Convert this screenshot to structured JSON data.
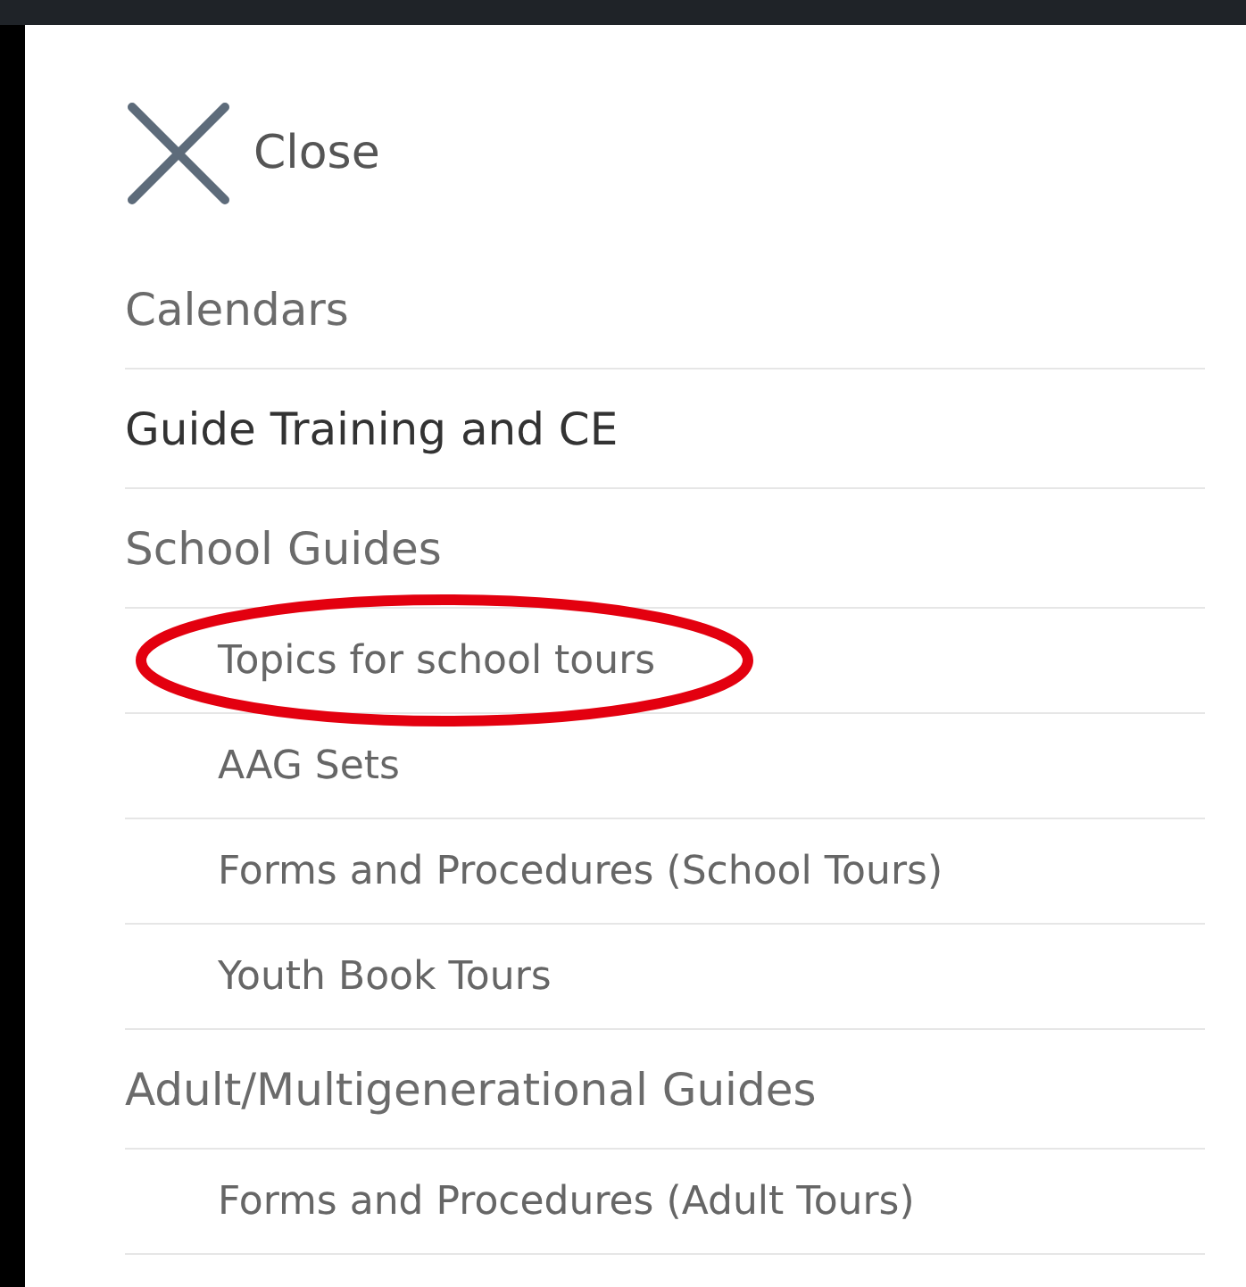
{
  "close_button": {
    "label": "Close"
  },
  "menu": [
    {
      "label": "Calendars",
      "active": false
    },
    {
      "label": "Guide Training and CE",
      "active": true
    },
    {
      "label": "School Guides",
      "active": false,
      "children": [
        {
          "label": "Topics for school tours",
          "circled": true
        },
        {
          "label": "AAG Sets",
          "circled": false
        },
        {
          "label": "Forms and Procedures (School Tours)",
          "circled": false
        },
        {
          "label": "Youth Book Tours",
          "circled": false
        }
      ]
    },
    {
      "label": "Adult/Multigenerational Guides",
      "active": false,
      "children": [
        {
          "label": "Forms and Procedures (Adult Tours)",
          "circled": false
        }
      ]
    }
  ]
}
